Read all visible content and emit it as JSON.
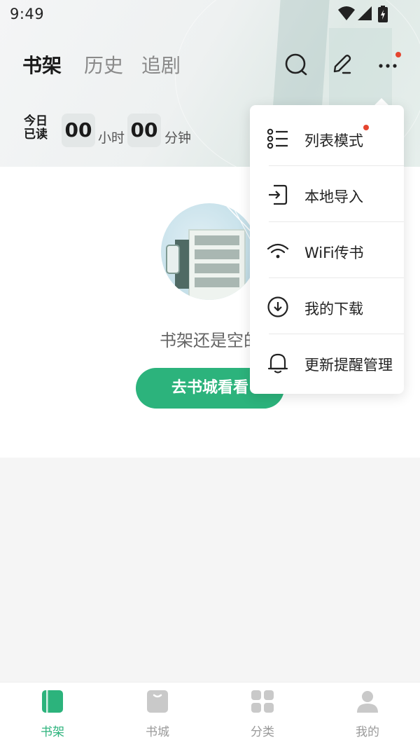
{
  "status_bar": {
    "time": "9:49"
  },
  "header": {
    "tabs": [
      {
        "label": "书架",
        "active": true
      },
      {
        "label": "历史",
        "active": false
      },
      {
        "label": "追剧",
        "active": false
      }
    ],
    "icons": [
      "search-icon",
      "edit-icon",
      "more-icon"
    ]
  },
  "reading_stats": {
    "label_line1": "今日",
    "label_line2": "已读",
    "hours": "00",
    "hours_unit": "小时",
    "minutes": "00",
    "minutes_unit": "分钟"
  },
  "empty_state": {
    "message": "书架还是空的",
    "button_label": "去书城看看"
  },
  "popup_menu": {
    "items": [
      {
        "label": "列表模式",
        "icon": "list-mode-icon",
        "badge": true
      },
      {
        "label": "本地导入",
        "icon": "import-icon",
        "badge": false
      },
      {
        "label": "WiFi传书",
        "icon": "wifi-icon",
        "badge": false
      },
      {
        "label": "我的下载",
        "icon": "download-icon",
        "badge": false
      },
      {
        "label": "更新提醒管理",
        "icon": "bell-icon",
        "badge": false
      }
    ]
  },
  "bottom_nav": {
    "items": [
      {
        "label": "书架",
        "icon": "bookshelf-icon",
        "active": true
      },
      {
        "label": "书城",
        "icon": "bookstore-icon",
        "active": false
      },
      {
        "label": "分类",
        "icon": "category-icon",
        "active": false
      },
      {
        "label": "我的",
        "icon": "profile-icon",
        "active": false
      }
    ]
  },
  "colors": {
    "accent": "#2cb37c",
    "badge": "#e5452f"
  }
}
